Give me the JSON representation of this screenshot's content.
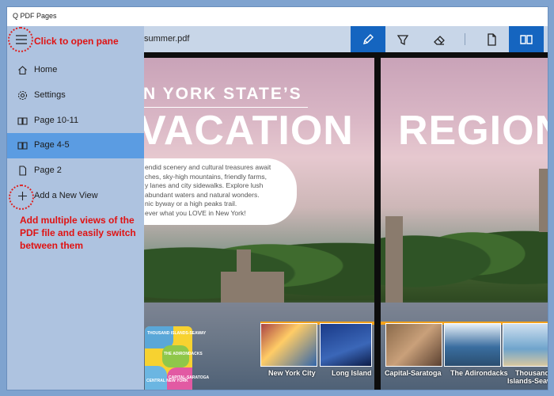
{
  "window": {
    "title": "Q PDF Pages"
  },
  "toolbar": {
    "filename": "summer.pdf",
    "tools": [
      {
        "name": "pen-tool",
        "icon": "pen-icon",
        "active": true
      },
      {
        "name": "highlighter-tool",
        "icon": "highlighter-icon",
        "active": false
      },
      {
        "name": "eraser-tool",
        "icon": "eraser-icon",
        "active": false
      },
      {
        "name": "single-page-view",
        "icon": "page-icon",
        "active": false
      },
      {
        "name": "two-page-view",
        "icon": "two-pages-icon",
        "active": true
      }
    ],
    "accent": "#1565c0"
  },
  "pane": {
    "items": [
      {
        "label": "Home",
        "icon": "home-icon"
      },
      {
        "label": "Settings",
        "icon": "gear-icon"
      },
      {
        "label": "Page 10-11",
        "icon": "two-pages-icon"
      },
      {
        "label": "Page 4-5",
        "icon": "two-pages-icon",
        "selected": true
      },
      {
        "label": "Page 2",
        "icon": "page-icon"
      },
      {
        "label": "Add a New View",
        "icon": "plus-icon"
      }
    ],
    "selected_color": "#5b9ce2"
  },
  "annotations": {
    "open_pane": "Click to open pane",
    "views_line1": "Add multiple views of the",
    "views_line2": "PDF file and easily switch",
    "views_line3": "between them",
    "color": "#e01212"
  },
  "document": {
    "left_heading_small": "N YORK STATE’S",
    "left_heading_big": "VACATION",
    "right_heading_big": "REGION",
    "intro_lines": [
      "endid scenery and cultural treasures await",
      "ches, sky-high mountains, friendly farms,",
      "y lanes and city sidewalks. Explore lush",
      "abundant waters and natural wonders.",
      "nic byway or a high peaks trail.",
      "ever what you LOVE in New York!"
    ],
    "map_labels": [
      "THOUSAND ISLANDS-SEAWAY",
      "THE ADIRONDACKS",
      "CENTRAL NEW YORK",
      "CAPITAL-SARATOGA"
    ],
    "thumbnails": [
      {
        "label": "New York City"
      },
      {
        "label": "Long Island"
      },
      {
        "label": "Capital-Saratoga"
      },
      {
        "label": "The Adirondacks"
      },
      {
        "label": "Thousand"
      },
      {
        "label": "Islands-Seaway"
      }
    ]
  }
}
